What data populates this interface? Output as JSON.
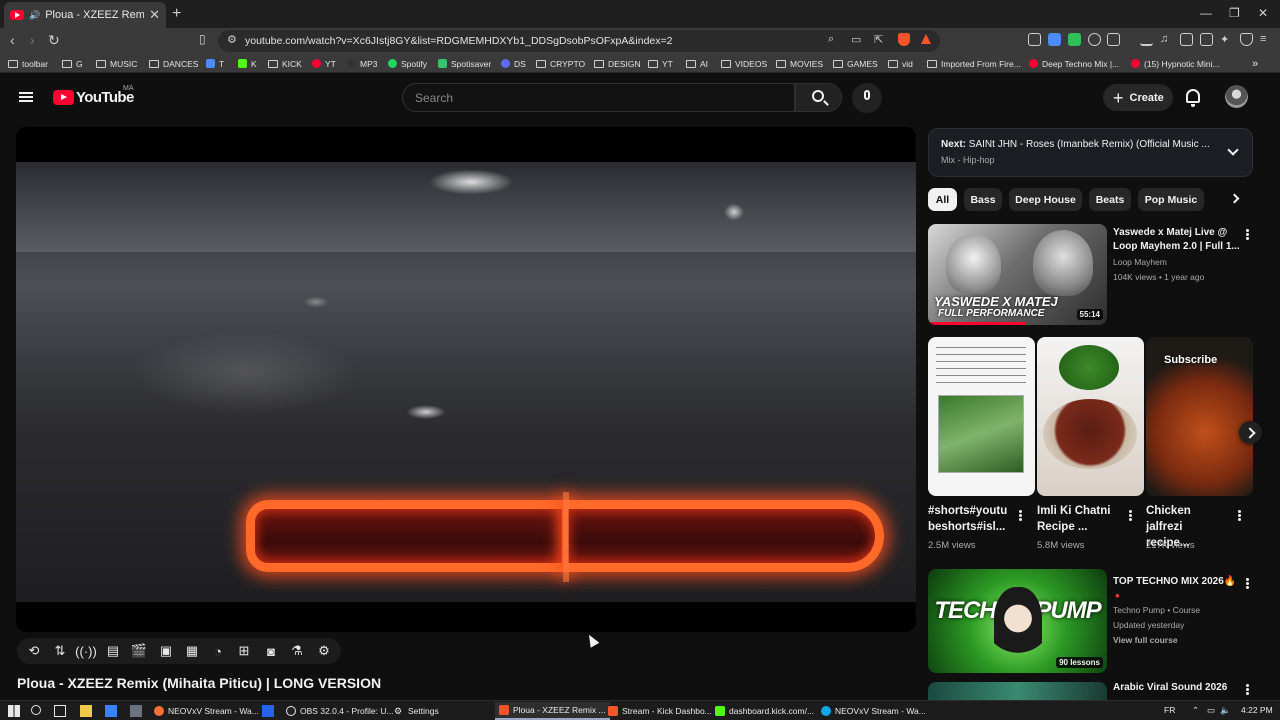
{
  "browser": {
    "active_tab_title": "Ploua - XZEEZ Remix (Mihaita",
    "url": "youtube.com/watch?v=Xc6JIstj8GY&list=RDGMEMHDXYb1_DDSgDsobPsOFxpA&index=2",
    "bookmarks": [
      "toolbar",
      "G",
      "MUSIC",
      "DANCES",
      "T",
      "K",
      "KICK",
      "YT",
      "MP3",
      "Spotify",
      "Spotisaver",
      "DS",
      "CRYPTO",
      "DESIGN",
      "YT",
      "AI",
      "VIDEOS",
      "MOVIES",
      "GAMES",
      "vid",
      "Imported From Fire...",
      "Deep Techno Mix |...",
      "(15) Hypnotic Mini..."
    ]
  },
  "youtube": {
    "logo_text": "YouTube",
    "region": "MA",
    "search_placeholder": "Search",
    "create_label": "Create"
  },
  "video": {
    "title": "Ploua - XZEEZ Remix (Mihaita Piticu) | LONG VERSION"
  },
  "next": {
    "label": "Next:",
    "title": "SAINt JHN - Roses (Imanbek Remix) (Official Music ...",
    "subtitle": "Mix - Hip-hop"
  },
  "chips": [
    "All",
    "Bass",
    "Deep House",
    "Beats",
    "Pop Music"
  ],
  "rec1": {
    "title_l1": "Yaswede x Matej Live @",
    "title_l2": "Loop Mayhem 2.0 | Full 1...",
    "channel": "Loop Mayhem",
    "stats": "104K views • 1 year ago",
    "duration": "55:14",
    "thumb_text_l1": "YASWEDE X MATEJ",
    "thumb_text_l2": "FULL PERFORMANCE",
    "watched_fraction": 0.55
  },
  "shorts": [
    {
      "title_l1": "#shorts#youtu",
      "title_l2": "beshorts#isl...",
      "views": "2.5M views"
    },
    {
      "title_l1": "Imli Ki Chatni",
      "title_l2": "Recipe ...",
      "views": "5.8M views"
    },
    {
      "title_l1": "Chicken",
      "title_l2": "jalfrezi recipe...",
      "views": "217K views"
    }
  ],
  "short_subscribe": "Subscribe",
  "rec2": {
    "title": "TOP TECHNO MIX 2026🔥",
    "channel": "Techno Pump • Course",
    "updated": "Updated yesterday",
    "link": "View full course",
    "lessons": "90 lessons",
    "thumb_text": "TECHNO PUMP"
  },
  "rec3": {
    "title": "Arabic Viral Sound 2026"
  },
  "taskbar": {
    "apps": [
      "NEOVxV Stream - Wa...",
      "OBS 32.0.4 - Profile: U...",
      "Settings",
      "Ploua - XZEEZ Remix ...",
      "Stream - Kick Dashbo...",
      "dashboard.kick.com/...",
      "NEOVxV Stream - Wa..."
    ],
    "lang": "FR",
    "time": "4:22 PM"
  },
  "colors": {
    "yt_red": "#ff0033",
    "background": "#0f0f0f",
    "chip_active": "#f1f1f1"
  }
}
